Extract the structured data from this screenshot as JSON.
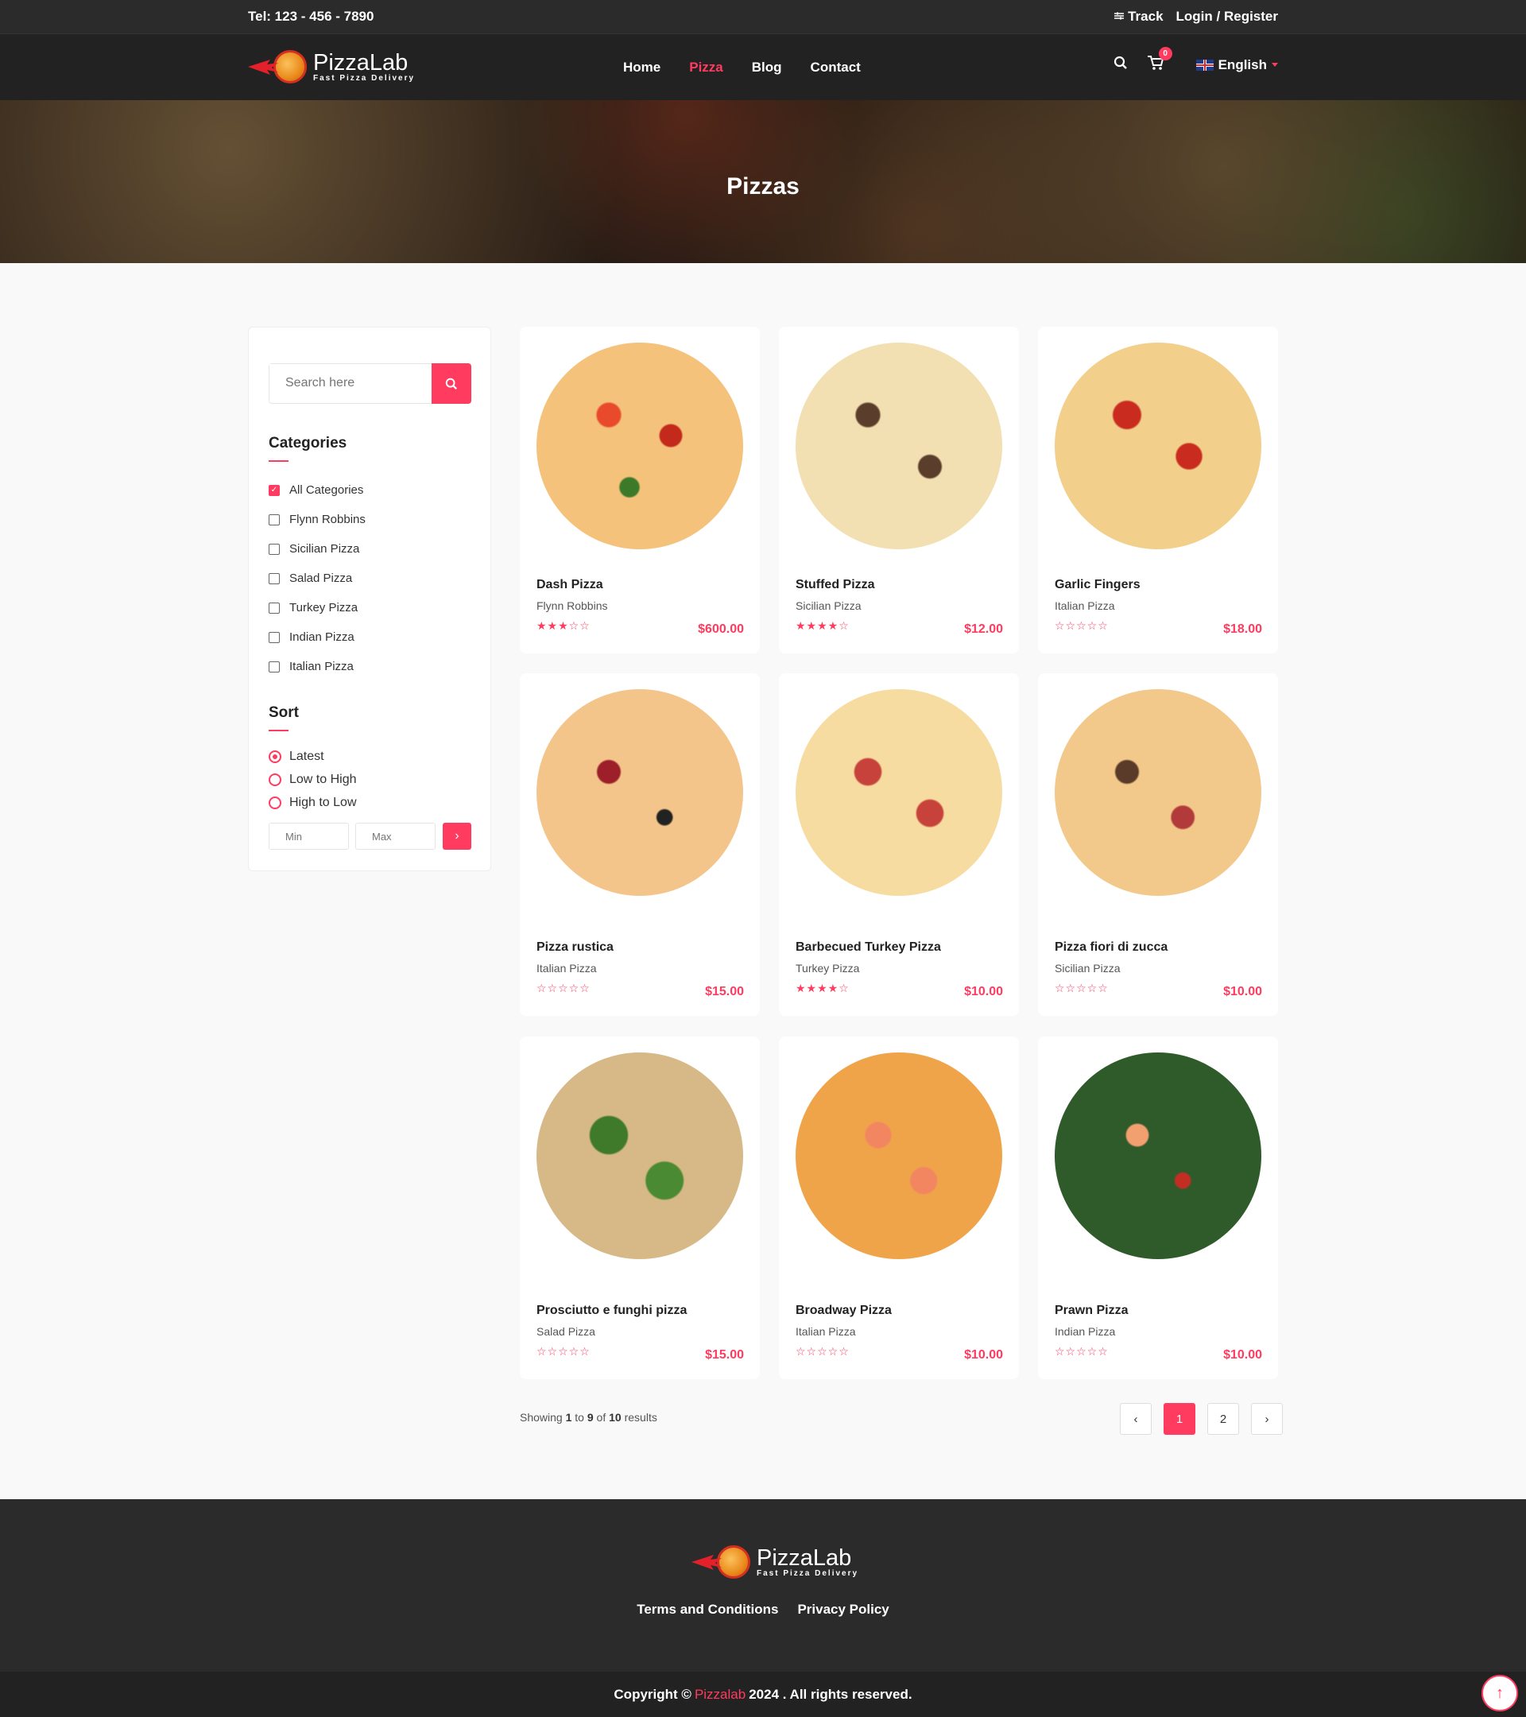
{
  "topbar": {
    "tel": "Tel: 123 - 456 - 7890",
    "track": "Track",
    "login": "Login / Register"
  },
  "nav": {
    "brand": "PizzaLab",
    "tagline": "Fast Pizza Delivery",
    "links": [
      "Home",
      "Pizza",
      "Blog",
      "Contact"
    ],
    "active_link": "Pizza",
    "cart_count": "0",
    "language": "English"
  },
  "hero": {
    "title": "Pizzas"
  },
  "sidebar": {
    "search_placeholder": "Search here",
    "categories_title": "Categories",
    "categories": [
      {
        "label": "All Categories",
        "checked": true
      },
      {
        "label": "Flynn Robbins",
        "checked": false
      },
      {
        "label": "Sicilian Pizza",
        "checked": false
      },
      {
        "label": "Salad Pizza",
        "checked": false
      },
      {
        "label": "Turkey Pizza",
        "checked": false
      },
      {
        "label": "Indian Pizza",
        "checked": false
      },
      {
        "label": "Italian Pizza",
        "checked": false
      }
    ],
    "sort_title": "Sort",
    "sort_options": [
      {
        "label": "Latest",
        "selected": true
      },
      {
        "label": "Low to High",
        "selected": false
      },
      {
        "label": "High to Low",
        "selected": false
      }
    ],
    "min_placeholder": "Min",
    "max_placeholder": "Max"
  },
  "products": [
    {
      "name": "Dash Pizza",
      "category": "Flynn Robbins",
      "rating": 3,
      "price": "$600.00"
    },
    {
      "name": "Stuffed Pizza",
      "category": "Sicilian Pizza",
      "rating": 4,
      "price": "$12.00"
    },
    {
      "name": "Garlic Fingers",
      "category": "Italian Pizza",
      "rating": 0,
      "price": "$18.00"
    },
    {
      "name": "Pizza rustica",
      "category": "Italian Pizza",
      "rating": 0,
      "price": "$15.00"
    },
    {
      "name": "Barbecued Turkey Pizza",
      "category": "Turkey Pizza",
      "rating": 4,
      "price": "$10.00"
    },
    {
      "name": "Pizza fiori di zucca",
      "category": "Sicilian Pizza",
      "rating": 0,
      "price": "$10.00"
    },
    {
      "name": "Prosciutto e funghi pizza",
      "category": "Salad Pizza",
      "rating": 0,
      "price": "$15.00"
    },
    {
      "name": "Broadway Pizza",
      "category": "Italian Pizza",
      "rating": 0,
      "price": "$10.00"
    },
    {
      "name": "Prawn Pizza",
      "category": "Indian Pizza",
      "rating": 0,
      "price": "$10.00"
    }
  ],
  "results": {
    "prefix": "Showing",
    "from": "1",
    "to_word": "to",
    "to": "9",
    "of_word": "of",
    "total": "10",
    "suffix": "results"
  },
  "pagination": {
    "prev": "‹",
    "pages": [
      "1",
      "2"
    ],
    "active": "1",
    "next": "›"
  },
  "footer": {
    "links": [
      "Terms and Conditions",
      "Privacy Policy"
    ],
    "copyright_prefix": "Copyright ©",
    "copyright_brand": "Pizzalab",
    "copyright_suffix": "2024 . All rights reserved."
  },
  "colors": {
    "accent": "#ff3b5f",
    "dark": "#2b2b2b",
    "darker": "#222222"
  }
}
